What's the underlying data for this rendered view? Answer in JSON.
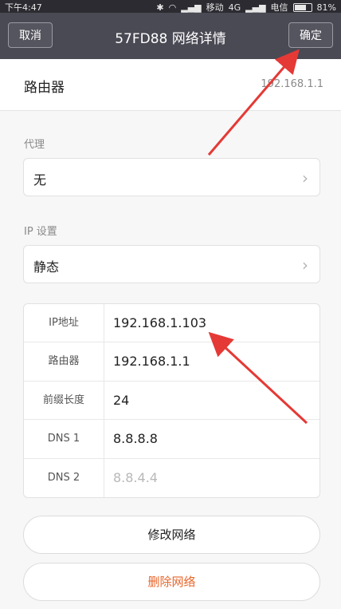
{
  "status_bar": {
    "time": "下午4:47",
    "carrier1": "移动",
    "network": "4G",
    "carrier2": "电信",
    "battery": "81%",
    "battery_level": 0.81
  },
  "header": {
    "cancel_label": "取消",
    "title": "57FD88  网络详情",
    "confirm_label": "确定"
  },
  "router": {
    "label": "路由器",
    "value": "192.168.1.1"
  },
  "proxy": {
    "section_label": "代理",
    "value": "无"
  },
  "ip_settings": {
    "section_label": "IP 设置",
    "value": "静态"
  },
  "ip_table": [
    {
      "key": "IP地址",
      "value": "192.168.1.103"
    },
    {
      "key": "路由器",
      "value": "192.168.1.1"
    },
    {
      "key": "前缀长度",
      "value": "24"
    },
    {
      "key": "DNS 1",
      "value": "8.8.8.8"
    },
    {
      "key": "DNS 2",
      "value": "8.8.4.4"
    }
  ],
  "buttons": {
    "modify": "修改网络",
    "delete": "删除网络"
  },
  "colors": {
    "header_bg": "#4a4a55",
    "danger": "#e8662b",
    "annotation_arrow": "#e53935"
  },
  "icons": [
    "bluetooth-icon",
    "wifi-icon",
    "signal-icon",
    "battery-icon",
    "chevron-right-icon"
  ]
}
